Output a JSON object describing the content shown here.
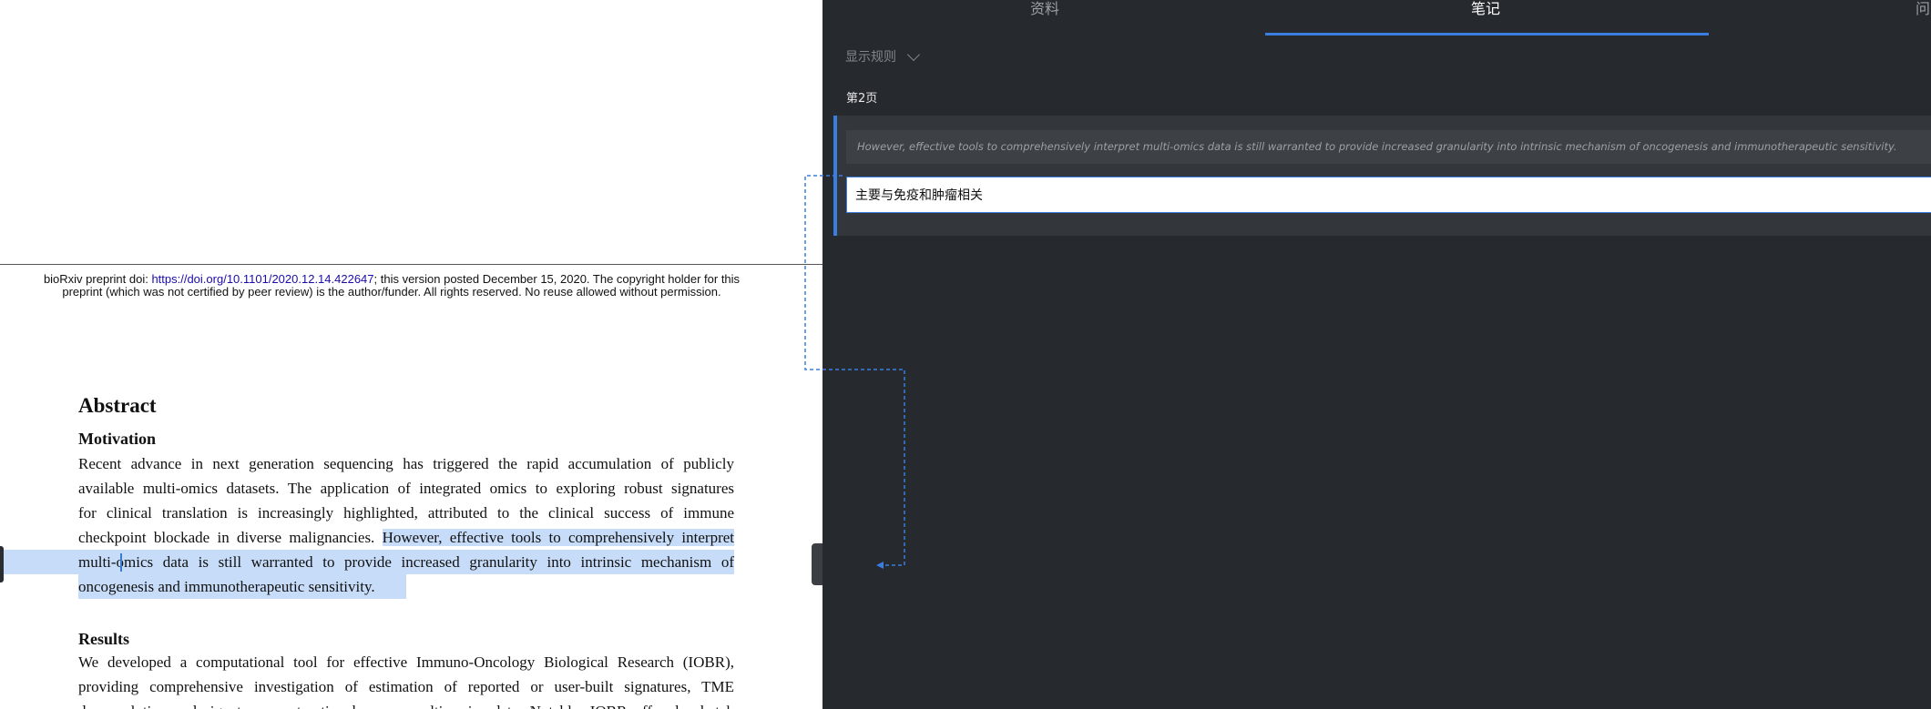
{
  "pdf": {
    "header_prefix": "bioRxiv preprint doi: ",
    "header_link": "https://doi.org/10.1101/2020.12.14.422647",
    "header_suffix": "; this version posted December 15, 2020. The copyright holder for this",
    "header_line2": "preprint (which was not certified by peer review) is the author/funder. All rights reserved. No reuse allowed without permission.",
    "abstract_title": "Abstract",
    "motivation_heading": "Motivation",
    "motivation_lines": [
      "Recent advance in next generation sequencing has triggered the rapid accumulation of publicly",
      "available multi-omics datasets. The application of integrated omics to exploring robust signatures",
      "for clinical translation is increasingly highlighted, attributed to the clinical success of immune"
    ],
    "line4_plain": "checkpoint blockade in diverse malignancies. ",
    "line4_highlight": "However, effective tools to comprehensively interpret",
    "line5_highlight": "multi-omics data is still warranted to provide increased granularity into intrinsic mechanism of",
    "line6_highlight": "oncogenesis and immunotherapeutic sensitivity.",
    "results_heading": "Results",
    "results_lines": [
      "We developed a computational tool for effective Immuno-Oncology Biological Research (IOBR),",
      "providing comprehensive investigation of estimation of reported or user-built signatures, TME",
      "deconvolution and signature construction base on multi-omics data. Notably, IOBR offered a batch"
    ]
  },
  "notes": {
    "tabs": [
      "资料",
      "笔记",
      "问"
    ],
    "active_tab": "笔记",
    "display_rule": "显示规则",
    "page_label": "第2页",
    "quote": "However, effective tools to comprehensively interpret multi-omics data is still warranted to provide increased granularity into intrinsic mechanism of oncogenesis and immunotherapeutic sensitivity.",
    "note_value": "主要与免疫和肿瘤相关",
    "accent_color": "#3a7ee0",
    "highlight_color": "#c7dcf8"
  }
}
